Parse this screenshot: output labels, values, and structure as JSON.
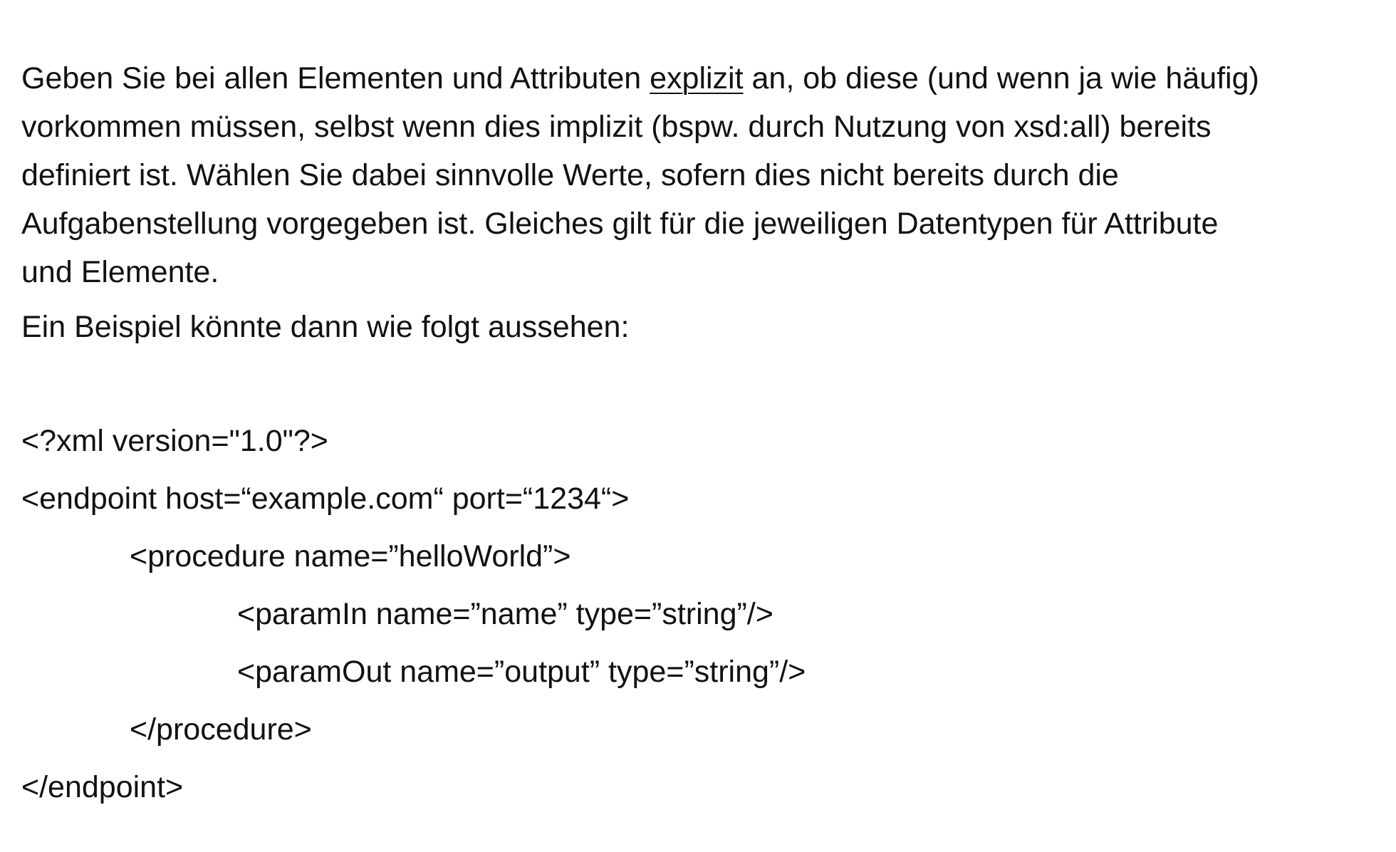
{
  "intro": {
    "line1_before": "Geben Sie bei allen Elementen und Attributen ",
    "line1_emphasis": "explizit",
    "line1_after": " an, ob diese (und wenn ja wie häufig)",
    "line2": "vorkommen müssen, selbst wenn dies implizit (bspw. durch Nutzung von xsd:all) bereits",
    "line3": "definiert ist. Wählen Sie dabei sinnvolle Werte, sofern dies nicht bereits durch die",
    "line4": "Aufgabenstellung vorgegeben ist. Gleiches gilt für die jeweiligen Datentypen für Attribute",
    "line5": "und Elemente."
  },
  "example_label": "Ein Beispiel könnte dann wie folgt aussehen:",
  "code_lines": [
    "<?xml version=\"1.0\"?>",
    "<endpoint host=“example.com“ port=“1234“>",
    "<procedure name=”helloWorld”>",
    "<paramIn name=”name” type=”string”/>",
    "<paramOut name=”output” type=”string”/>",
    "</procedure>",
    "</endpoint>"
  ]
}
